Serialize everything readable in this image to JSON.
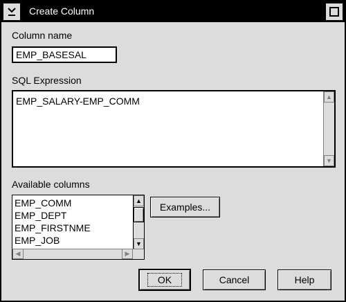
{
  "window": {
    "title": "Create Column"
  },
  "column_name": {
    "label": "Column name",
    "value": "EMP_BASESAL"
  },
  "sql_expression": {
    "label": "SQL Expression",
    "value": "EMP_SALARY-EMP_COMM"
  },
  "available_columns": {
    "label": "Available columns",
    "items": [
      "EMP_COMM",
      "EMP_DEPT",
      "EMP_FIRSTNME",
      "EMP_JOB"
    ]
  },
  "buttons": {
    "examples": "Examples...",
    "ok": "OK",
    "cancel": "Cancel",
    "help": "Help"
  },
  "icons": {
    "system_menu": "system-menu-icon",
    "maximize": "maximize-icon"
  }
}
